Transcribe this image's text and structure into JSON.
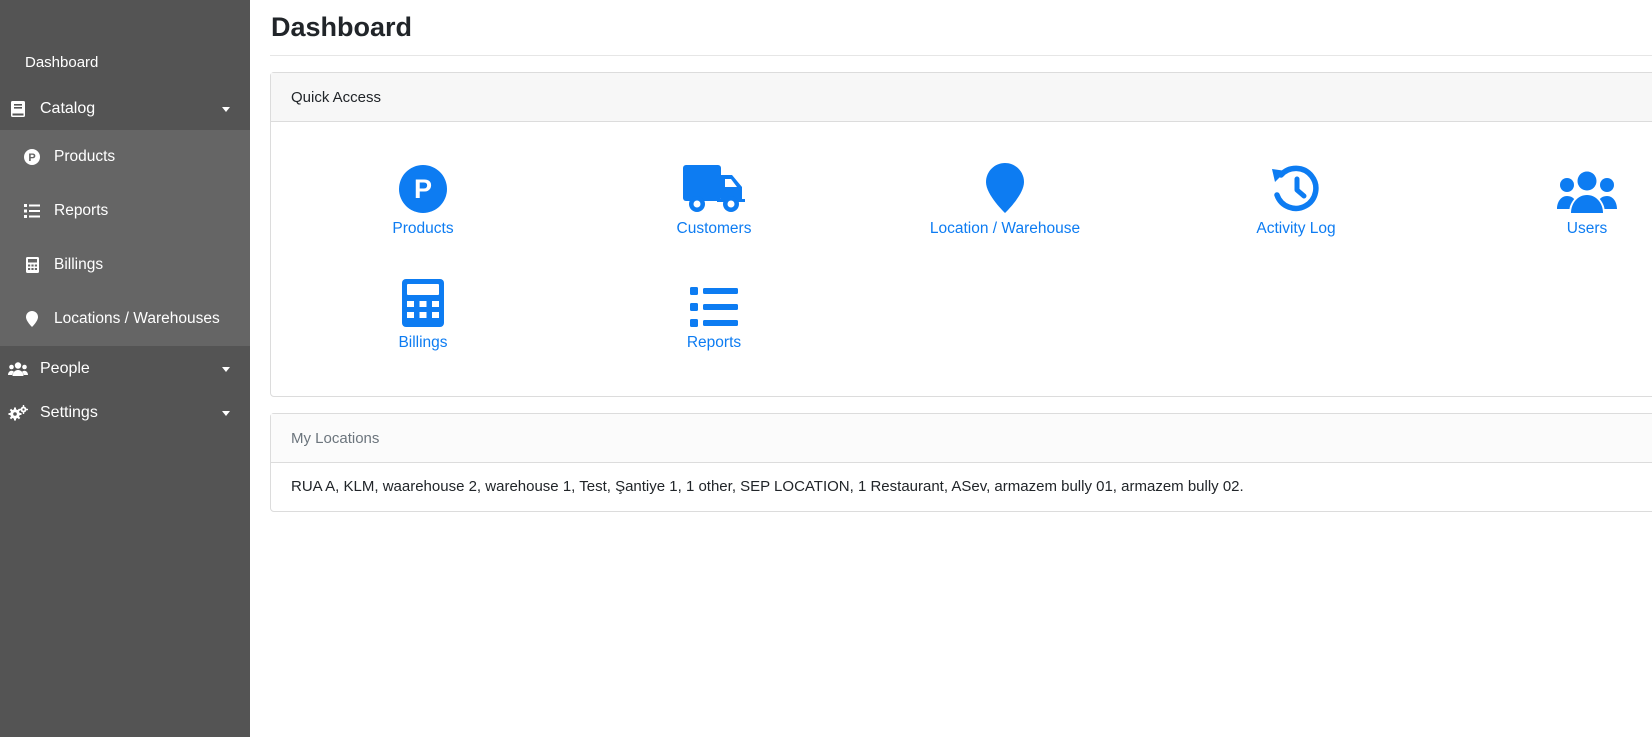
{
  "sidebar": {
    "dashboard_label": "Dashboard",
    "catalog": {
      "label": "Catalog",
      "items": [
        {
          "label": "Products",
          "icon": "product-p-icon"
        },
        {
          "label": "Reports",
          "icon": "list-icon"
        },
        {
          "label": "Billings",
          "icon": "calculator-icon"
        },
        {
          "label": "Locations / Warehouses",
          "icon": "map-marker-icon"
        }
      ]
    },
    "people": {
      "label": "People",
      "icon": "users-icon"
    },
    "settings": {
      "label": "Settings",
      "icon": "gears-icon"
    }
  },
  "page": {
    "title": "Dashboard"
  },
  "quick_access": {
    "header": "Quick Access",
    "accent_color": "#0d7cf2",
    "items": [
      {
        "label": "Products",
        "icon": "product-p-icon"
      },
      {
        "label": "Customers",
        "icon": "truck-icon"
      },
      {
        "label": "Location / Warehouse",
        "icon": "map-marker-icon"
      },
      {
        "label": "Activity Log",
        "icon": "history-icon"
      },
      {
        "label": "Users",
        "icon": "users-icon"
      },
      {
        "label": "Billings",
        "icon": "calculator-icon"
      },
      {
        "label": "Reports",
        "icon": "list-icon"
      }
    ]
  },
  "my_locations": {
    "header": "My Locations",
    "text": "RUA A, KLM, waarehouse 2, warehouse 1, Test, Şantiye 1, 1 other, SEP LOCATION, 1 Restaurant, ASev, armazem bully 01, armazem bully 02."
  },
  "colors": {
    "sidebar_bg": "#545454",
    "sidebar_sub_bg": "#656565",
    "accent": "#0d7cf2"
  }
}
